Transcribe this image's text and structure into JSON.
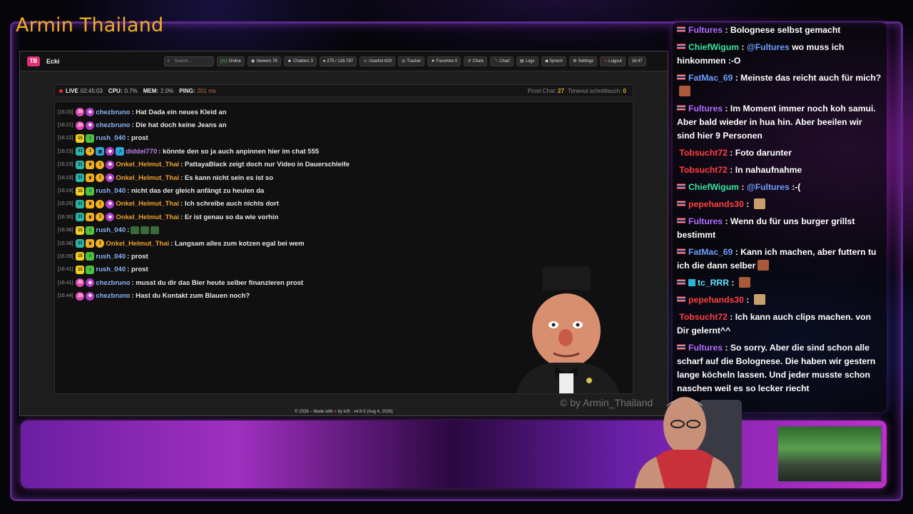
{
  "overlay": {
    "channel_title": "Armin Thailand",
    "watermark": "© by Armin_Thailand"
  },
  "navbar": {
    "brand": "Ecki",
    "logo_text": "TB",
    "search_placeholder": "Search...",
    "buttons": {
      "online": "Online",
      "viewers": "Viewers 76",
      "chatters": "Chatters 3",
      "messages": "275 / 126.787",
      "userlist": "Userlist 629",
      "tracker": "Tracker",
      "favorites": "Favorites 0",
      "chats": "Chats",
      "chart": "Chart",
      "logs": "Logs",
      "sprech": "Sprech",
      "settings": "Settings",
      "logout": "Logout"
    },
    "clock": "16:47"
  },
  "status": {
    "live_label": "LIVE",
    "live_time": "02:45:03",
    "cpu_label": "CPU:",
    "cpu_value": "0.7%",
    "mem_label": "MEM:",
    "mem_value": "2.0%",
    "ping_label": "PING:",
    "ping_value": "201 ms",
    "prost_label": "Prost Chat:",
    "prost_value": "27",
    "timeout_label": "Timeout schnittlauch:",
    "timeout_value": "0"
  },
  "chat_messages": [
    {
      "time": "[16:20]",
      "user": "chezbruno",
      "text": "Hat Dada ein neues Kleid an"
    },
    {
      "time": "[16:21]",
      "user": "chezbruno",
      "text": "Die hat doch keine Jeans an"
    },
    {
      "time": "[16:22]",
      "user": "rush_040",
      "text": "prost"
    },
    {
      "time": "[16:23]",
      "user": "diddel770",
      "text": "könnte den so ja auch anpinnen hier im chat 555"
    },
    {
      "time": "[16:23]",
      "user": "Onkel_Helmut_Thai",
      "text": "PattayaBlack zeigt doch nur Video in Dauerschleife"
    },
    {
      "time": "[16:23]",
      "user": "Onkel_Helmut_Thai",
      "text": "Es kann nicht sein es ist so"
    },
    {
      "time": "[16:24]",
      "user": "rush_040",
      "text": "nicht das der gleich anfängt zu heulen da"
    },
    {
      "time": "[16:26]",
      "user": "Onkel_Helmut_Thai",
      "text": "Ich schreibe auch nichts dort"
    },
    {
      "time": "[16:35]",
      "user": "Onkel_Helmut_Thai",
      "text": "Er ist genau so da wie vorhin"
    },
    {
      "time": "[16:36]",
      "user": "rush_040",
      "text": ""
    },
    {
      "time": "[16:38]",
      "user": "Onkel_Helmut_Thai",
      "text": "Langsam alles zum kotzen egal bei wem"
    },
    {
      "time": "[16:39]",
      "user": "rush_040",
      "text": "prost"
    },
    {
      "time": "[16:41]",
      "user": "rush_040",
      "text": "prost"
    },
    {
      "time": "[16:41]",
      "user": "chezbruno",
      "text": "musst du dir das Bier heute selber finanzieren prost"
    },
    {
      "time": "[16:44]",
      "user": "chezbruno",
      "text": "Hast du Kontakt zum Blauen noch?"
    }
  ],
  "footer": {
    "prefix": "© 2026 – Made with",
    "suffix": "by tcR · v4.9-5 (Aug 4, 2026)"
  },
  "side_chat": [
    {
      "user": "Fultures",
      "text": "Bolognese selbst gemacht"
    },
    {
      "user": "ChiefWigum",
      "mention": "@Fultures",
      "text": "wo muss ich hinkommen :-O"
    },
    {
      "user": "FatMac_69",
      "text": "Meinste das reicht auch für mich?"
    },
    {
      "user": "Fultures",
      "text": "Im Moment immer noch koh samui. Aber bald wieder in hua hin. Aber beeilen wir sind hier 9 Personen"
    },
    {
      "user": "Tobsucht72",
      "text": "Foto darunter"
    },
    {
      "user": "Tobsucht72",
      "text": "In nahaufnahme"
    },
    {
      "user": "ChiefWigum",
      "mention": "@Fultures",
      "text": ":-("
    },
    {
      "user": "pepehands30",
      "text": ""
    },
    {
      "user": "Fultures",
      "text": "Wenn du für uns burger grillst bestimmt"
    },
    {
      "user": "FatMac_69",
      "text": "Kann ich machen, aber futtern tu ich die dann selber"
    },
    {
      "user": "tc_RRR",
      "text": ""
    },
    {
      "user": "pepehands30",
      "text": ""
    },
    {
      "user": "Tobsucht72",
      "text": "Ich kann auch clips machen. von Dir gelernt^^"
    },
    {
      "user": "Fultures",
      "text": "So sorry. Aber die sind schon alle scharf auf die Bolognese. Die haben wir gestern lange köcheln lassen. Und jeder musste schon naschen weil es so lecker riecht"
    }
  ],
  "colors": {
    "accent_gold": "#f0b020",
    "frame_purple": "#5a2a8a",
    "live_red": "#e03030"
  }
}
